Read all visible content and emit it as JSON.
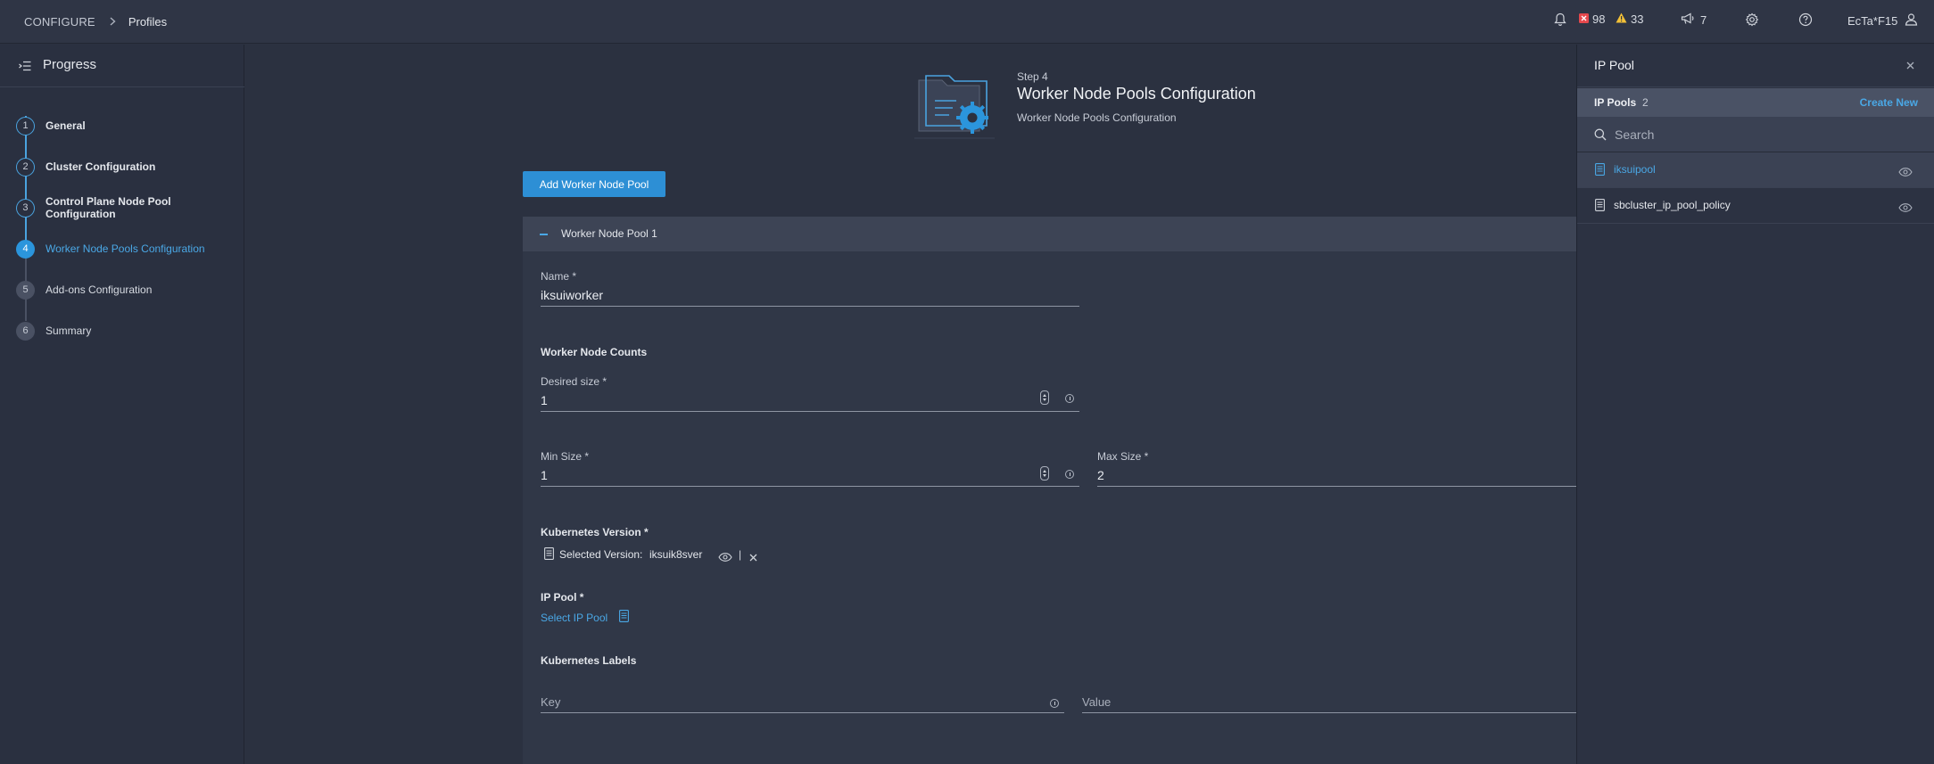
{
  "header": {
    "breadcrumb": [
      "CONFIGURE",
      "Profiles"
    ],
    "critical_count": "98",
    "warning_count": "33",
    "announcement_count": "7",
    "user": "EcTa*F15",
    "colors": {
      "critical": "#e5484d",
      "warning": "#f2c037"
    }
  },
  "progress": {
    "title": "Progress",
    "steps": [
      {
        "num": "1",
        "label": "General",
        "state": "done"
      },
      {
        "num": "2",
        "label": "Cluster Configuration",
        "state": "done"
      },
      {
        "num": "3",
        "label": "Control Plane Node Pool Configuration",
        "state": "done"
      },
      {
        "num": "4",
        "label": "Worker Node Pools Configuration",
        "state": "active"
      },
      {
        "num": "5",
        "label": "Add-ons Configuration",
        "state": "todo"
      },
      {
        "num": "6",
        "label": "Summary",
        "state": "todo"
      }
    ]
  },
  "main": {
    "step_label": "Step 4",
    "title": "Worker Node Pools Configuration",
    "subtitle": "Worker Node Pools Configuration",
    "add_button": "Add Worker Node Pool",
    "pool": {
      "title": "Worker Node Pool 1",
      "name_label": "Name *",
      "name_value": "iksuiworker",
      "counts_title": "Worker Node Counts",
      "desired_label": "Desired size *",
      "desired_value": "1",
      "min_label": "Min Size *",
      "min_value": "1",
      "max_label": "Max Size *",
      "max_value": "2",
      "k8s_version_title": "Kubernetes Version *",
      "selected_version_label": "Selected Version:",
      "selected_version_value": "iksuik8sver",
      "divider": "|",
      "ip_pool_title": "IP Pool *",
      "select_ip_pool": "Select IP Pool",
      "labels_title": "Kubernetes Labels",
      "key_placeholder": "Key",
      "value_placeholder": "Value"
    }
  },
  "drawer": {
    "title": "IP Pool",
    "list_title": "IP Pools",
    "list_count": "2",
    "create_new": "Create New",
    "search_placeholder": "Search",
    "items": [
      {
        "name": "iksuipool",
        "selected": true
      },
      {
        "name": "sbcluster_ip_pool_policy",
        "selected": false
      }
    ]
  },
  "icons": [
    "bell-icon",
    "critical-icon",
    "warning-icon",
    "megaphone-icon",
    "gear-icon",
    "help-icon",
    "user-icon",
    "list-collapse-icon",
    "folder-gear-icon",
    "document-icon",
    "eye-icon",
    "close-icon",
    "search-icon",
    "chevron-right-icon"
  ],
  "accent_color": "#2d8fd5"
}
